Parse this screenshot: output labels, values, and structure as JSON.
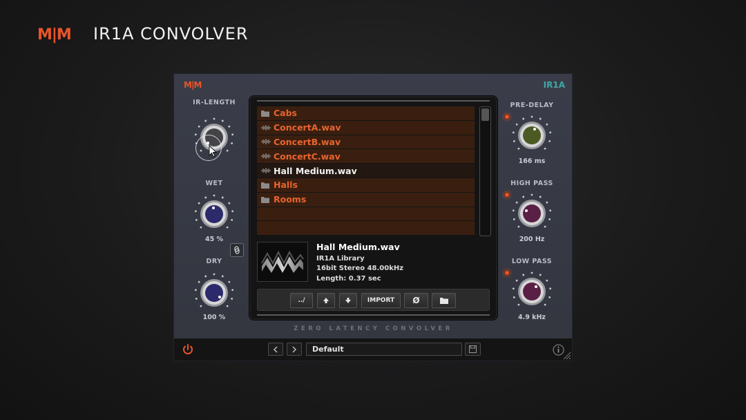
{
  "header": {
    "logo": "M|M",
    "title": "IR1A CONVOLVER"
  },
  "plugin": {
    "logo": "M|M",
    "name": "IR1A",
    "tagline": "ZERO LATENCY CONVOLVER",
    "left_knobs": [
      {
        "label": "IR-LENGTH",
        "value": "",
        "cap_color": "#444448"
      },
      {
        "label": "WET",
        "value": "45 %",
        "cap_color": "#2c2a6a"
      },
      {
        "label": "DRY",
        "value": "100 %",
        "cap_color": "#2c2a6a"
      }
    ],
    "right_knobs": [
      {
        "label": "PRE-DELAY",
        "value": "166 ms",
        "cap_color": "#4a5a22"
      },
      {
        "label": "HIGH PASS",
        "value": "200 Hz",
        "cap_color": "#5a1f44"
      },
      {
        "label": "LOW PASS",
        "value": "4.9 kHz",
        "cap_color": "#5a1f44"
      }
    ],
    "files": [
      {
        "name": "Cabs",
        "icon": "folder-icon",
        "selected": false
      },
      {
        "name": "ConcertA.wav",
        "icon": "waveform-icon",
        "selected": false
      },
      {
        "name": "ConcertB.wav",
        "icon": "waveform-icon",
        "selected": false
      },
      {
        "name": "ConcertC.wav",
        "icon": "waveform-icon",
        "selected": false
      },
      {
        "name": "Hall Medium.wav",
        "icon": "waveform-icon",
        "selected": true
      },
      {
        "name": "Halls",
        "icon": "folder-icon",
        "selected": false
      },
      {
        "name": "Rooms",
        "icon": "folder-icon",
        "selected": false
      },
      {
        "name": "",
        "icon": "",
        "selected": false
      },
      {
        "name": "",
        "icon": "",
        "selected": false
      }
    ],
    "info": {
      "name": "Hall Medium.wav",
      "library": "IR1A Library",
      "format": "16bit Stereo 48.00kHz",
      "length": "Length: 0.37 sec"
    },
    "toolbar": {
      "up_dir": "../",
      "import": "IMPORT",
      "clear": "Ø"
    },
    "bottom": {
      "preset": "Default"
    },
    "colors": {
      "accent": "#e8552a",
      "teal": "#3fa7a6",
      "row_bg": "#3a1f10",
      "row_text": "#e8642f"
    }
  }
}
